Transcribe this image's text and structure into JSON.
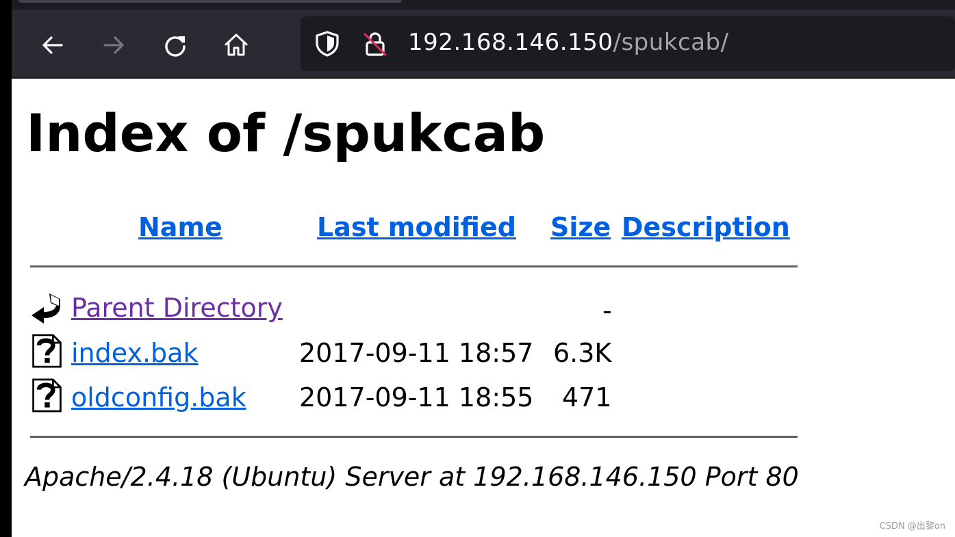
{
  "browser": {
    "url_host": "192.168.146.150",
    "url_path": "/spukcab/",
    "icons": [
      "back-arrow-icon",
      "forward-arrow-icon",
      "reload-icon",
      "home-icon",
      "shield-icon",
      "insecure-lock-icon"
    ]
  },
  "page": {
    "title": "Index of /spukcab",
    "columns": {
      "name": "Name",
      "last_modified": "Last modified",
      "size": "Size",
      "description": "Description"
    },
    "rows": [
      {
        "icon": "back-icon",
        "name": "Parent Directory",
        "modified": "",
        "size": "-"
      },
      {
        "icon": "unknown-file-icon",
        "name": "index.bak",
        "modified": "2017-09-11 18:57",
        "size": "6.3K"
      },
      {
        "icon": "unknown-file-icon",
        "name": "oldconfig.bak",
        "modified": "2017-09-11 18:55",
        "size": "471"
      }
    ],
    "address": "Apache/2.4.18 (Ubuntu) Server at 192.168.146.150 Port 80"
  },
  "watermark": "CSDN @出黎on",
  "colors": {
    "toolbar": "#2b2a33",
    "urlbar": "#1c1b22",
    "link": "#0060df",
    "visited_link": "#6a2fa0"
  }
}
